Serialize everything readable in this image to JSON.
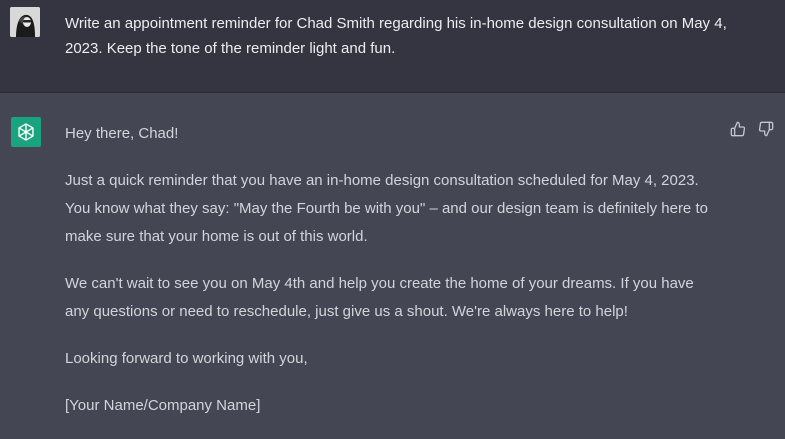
{
  "user_message": {
    "text": "Write an appointment reminder for Chad Smith regarding his in-home design consultation on May 4, 2023. Keep the tone of the reminder light and fun."
  },
  "assistant_message": {
    "paragraphs": [
      "Hey there, Chad!",
      "Just a quick reminder that you have an in-home design consultation scheduled for May 4, 2023. You know what they say: \"May the Fourth be with you\" – and our design team is definitely here to make sure that your home is out of this world.",
      "We can't wait to see you on May 4th and help you create the home of your dreams. If you have any questions or need to reschedule, just give us a shout. We're always here to help!",
      "Looking forward to working with you,",
      "[Your Name/Company Name]"
    ]
  },
  "icons": {
    "user_avatar": "user-avatar-image",
    "assistant_avatar": "openai-logo-icon",
    "thumbs_up": "thumbs-up-icon",
    "thumbs_down": "thumbs-down-icon"
  },
  "colors": {
    "user_bg": "#343541",
    "assistant_bg": "#444654",
    "assistant_avatar_bg": "#19a37f",
    "text": "#d1d5db"
  }
}
